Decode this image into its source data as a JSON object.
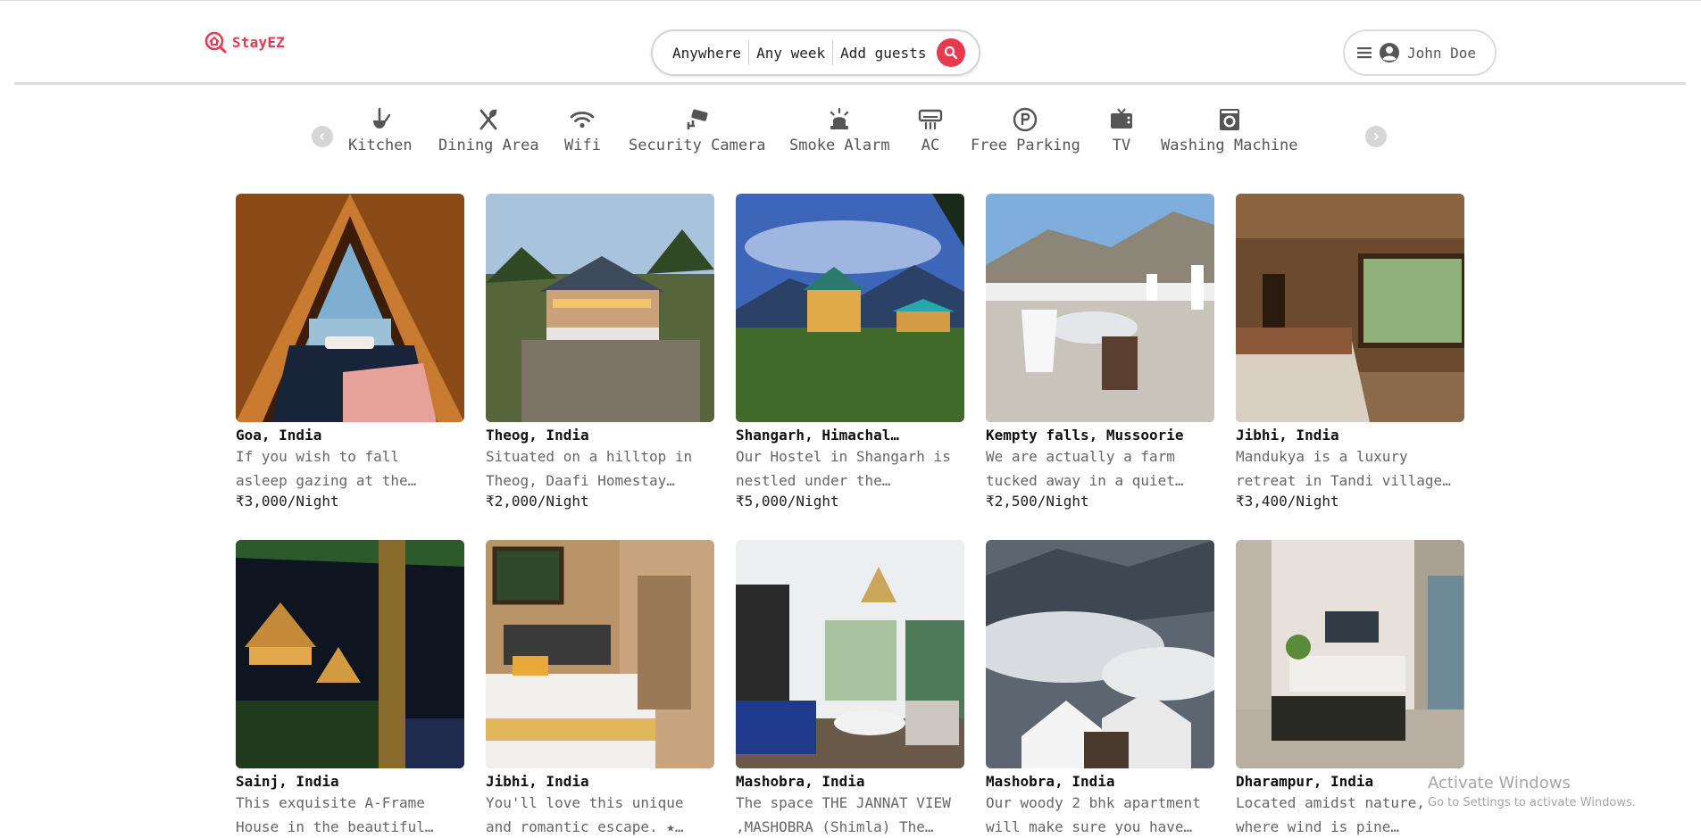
{
  "brand": {
    "name": "StayEZ",
    "color": "#e8394f"
  },
  "search": {
    "where": "Anywhere",
    "when": "Any week",
    "guests": "Add guests",
    "icon": "search-icon"
  },
  "user": {
    "name": "John Doe",
    "menu_icon": "hamburger-icon",
    "avatar_icon": "user-circle-icon"
  },
  "amenities": [
    {
      "label": "Kitchen",
      "icon": "ladle-icon"
    },
    {
      "label": "Dining Area",
      "icon": "fork-knife-icon"
    },
    {
      "label": "Wifi",
      "icon": "wifi-icon"
    },
    {
      "label": "Security Camera",
      "icon": "security-camera-icon"
    },
    {
      "label": "Smoke Alarm",
      "icon": "alarm-icon"
    },
    {
      "label": "AC",
      "icon": "air-conditioner-icon"
    },
    {
      "label": "Free Parking",
      "icon": "parking-icon"
    },
    {
      "label": "TV",
      "icon": "tv-icon"
    },
    {
      "label": "Washing Machine",
      "icon": "washing-machine-icon"
    }
  ],
  "listings": [
    {
      "title": "Goa, India",
      "desc1": "If you wish to fall",
      "desc2": "asleep gazing at the…",
      "price": "₹3,000/Night"
    },
    {
      "title": "Theog, India",
      "desc1": "Situated on a hilltop in",
      "desc2": "Theog, Daafi Homestay…",
      "price": "₹2,000/Night"
    },
    {
      "title": "Shangarh, Himachal…",
      "desc1": "Our Hostel in Shangarh is",
      "desc2": "nestled under the…",
      "price": "₹5,000/Night"
    },
    {
      "title": "Kempty falls, Mussoorie",
      "desc1": "We are actually a farm",
      "desc2": "tucked away in a quiet…",
      "price": "₹2,500/Night"
    },
    {
      "title": "Jibhi, India",
      "desc1": "Mandukya is a luxury",
      "desc2": "retreat in Tandi village…",
      "price": "₹3,400/Night"
    },
    {
      "title": "Sainj, India",
      "desc1": "This exquisite A-Frame",
      "desc2": "House in the beautiful…",
      "price": ""
    },
    {
      "title": "Jibhi, India",
      "desc1": "You'll love this unique",
      "desc2": "and romantic escape. ★…",
      "price": ""
    },
    {
      "title": "Mashobra, India",
      "desc1": "The space THE JANNAT VIEW",
      "desc2": ",MASHOBRA (Shimla) The…",
      "price": ""
    },
    {
      "title": "Mashobra, India",
      "desc1": "Our woody 2 bhk apartment",
      "desc2": "will make sure you have…",
      "price": ""
    },
    {
      "title": "Dharampur, India",
      "desc1": "Located amidst nature,",
      "desc2": "where wind is pine…",
      "price": ""
    }
  ],
  "watermark": {
    "title": "Activate Windows",
    "subtitle": "Go to Settings to activate Windows."
  }
}
